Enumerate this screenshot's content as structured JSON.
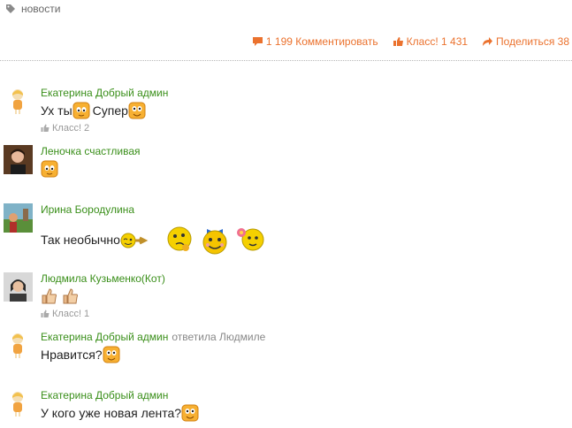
{
  "header": {
    "tag": "новости"
  },
  "actions": {
    "comments": "1 199 Комментировать",
    "klass": "Класс! 1 431",
    "share": "Поделиться 38"
  },
  "comments": [
    {
      "author": "Екатерина Добрый админ",
      "text_a": "Ух ты",
      "text_b": "Супер",
      "likes": "Класс! 2"
    },
    {
      "author": "Леночка счастливая"
    },
    {
      "author": "Ирина Бородулина",
      "text": "Так необычно"
    },
    {
      "author": "Людмила Кузьменко(Кот)",
      "likes": "Класс! 1"
    },
    {
      "author": "Екатерина Добрый админ",
      "reply_to": "ответила Людмиле",
      "text": "Нравится?"
    },
    {
      "author": "Екатерина Добрый админ",
      "text": "У кого уже новая лента?"
    }
  ],
  "icons": {
    "tag": "tag-icon",
    "comment": "speech-bubble-icon",
    "like": "thumbs-up-icon",
    "share": "share-arrow-icon"
  },
  "colors": {
    "accent": "#eb722e",
    "author": "#3a8f1a",
    "muted": "#999999"
  }
}
